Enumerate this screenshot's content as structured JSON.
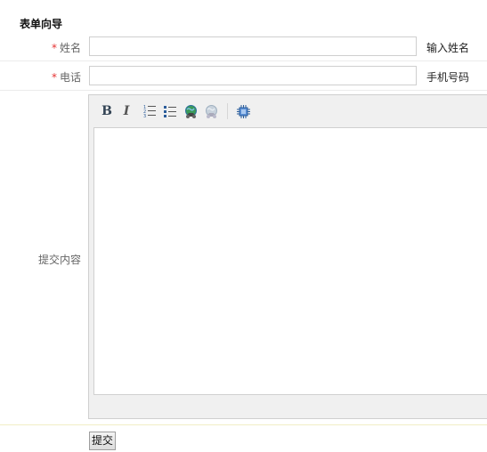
{
  "form": {
    "title": "表单向导"
  },
  "fields": {
    "name": {
      "required_mark": "*",
      "label": "姓名",
      "value": "",
      "hint": "输入姓名"
    },
    "phone": {
      "required_mark": "*",
      "label": "电话",
      "value": "",
      "hint": "手机号码"
    },
    "content": {
      "label": "提交内容",
      "value": ""
    }
  },
  "toolbar": {
    "buttons": [
      {
        "name": "bold",
        "glyph": "B"
      },
      {
        "name": "italic",
        "glyph": "I"
      },
      {
        "name": "ordered-list",
        "icon": "ordered-list-icon"
      },
      {
        "name": "unordered-list",
        "icon": "unordered-list-icon"
      },
      {
        "name": "link",
        "icon": "link-globe-icon"
      },
      {
        "name": "unlink",
        "icon": "unlink-globe-icon"
      },
      {
        "name": "source",
        "icon": "chip-icon"
      }
    ]
  },
  "submit": {
    "label": "提交"
  },
  "colors": {
    "required": "#e53333",
    "label": "#666666",
    "accent": "#2a7fd4"
  }
}
